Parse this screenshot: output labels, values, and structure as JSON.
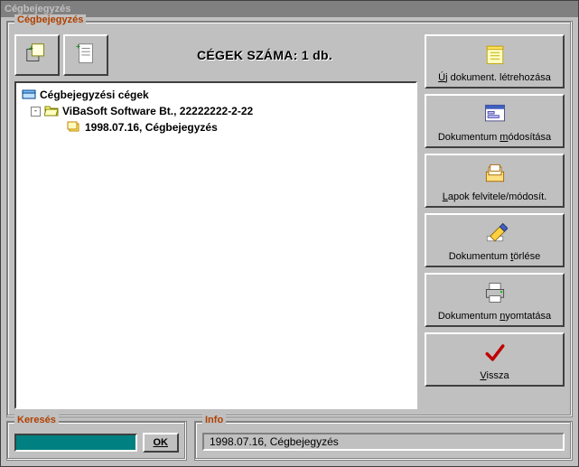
{
  "window": {
    "title": "Cégbejegyzés"
  },
  "main_group": {
    "legend": "Cégbejegyzés"
  },
  "count_label": "CÉGEK SZÁMA:  1 db.",
  "tree": {
    "root": {
      "label": "Cégbejegyzési cégek"
    },
    "company": {
      "label": "ViBaSoft Software Bt., 22222222-2-22"
    },
    "doc": {
      "label": "1998.07.16, Cégbejegyzés"
    }
  },
  "actions": {
    "new_doc": "Új dokument. létrehozása",
    "modify_doc": "Dokumentum módosítása",
    "pages": "Lapok felvitele/módosít.",
    "delete_doc": "Dokumentum törlése",
    "print_doc": "Dokumentum nyomtatása",
    "back": "Vissza"
  },
  "search_group": {
    "legend": "Keresés",
    "ok": "OK"
  },
  "info_group": {
    "legend": "Info",
    "value": "1998.07.16, Cégbejegyzés"
  }
}
